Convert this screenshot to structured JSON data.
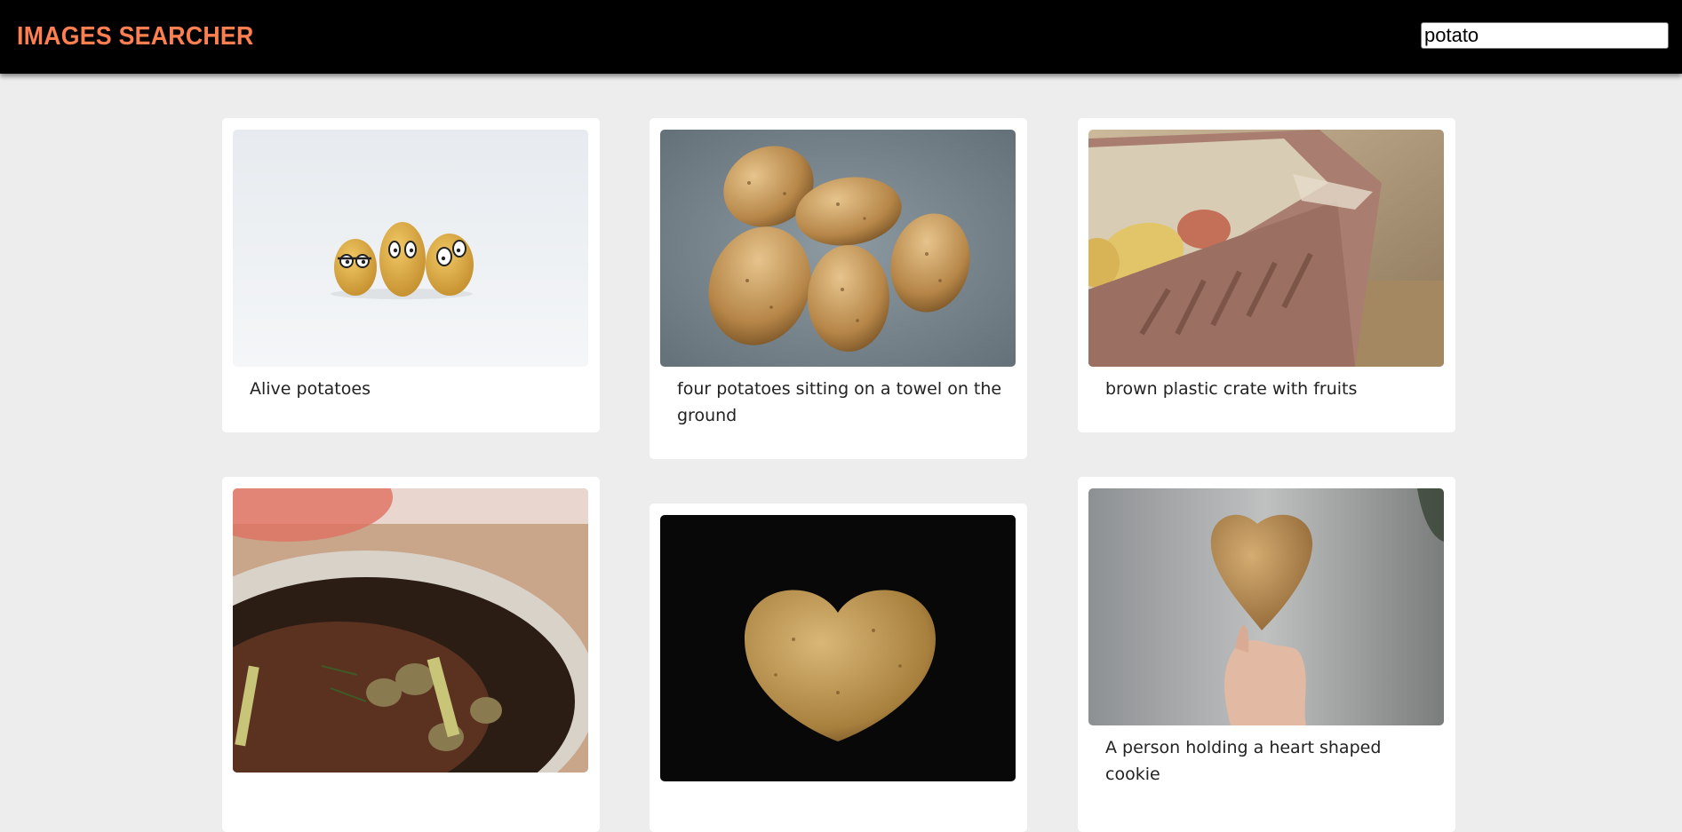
{
  "header": {
    "title": "IMAGES SEARCHER",
    "search_value": "potato"
  },
  "results": [
    {
      "caption": "Alive potatoes",
      "image": "alive-potatoes-image"
    },
    {
      "caption": "four potatoes sitting on a towel on the ground",
      "image": "potatoes-on-towel-image"
    },
    {
      "caption": "brown plastic crate with fruits",
      "image": "crate-with-fruits-image"
    },
    {
      "caption": "",
      "image": "roasted-potatoes-pot-image"
    },
    {
      "caption": "",
      "image": "heart-potato-dark-image"
    },
    {
      "caption": "A person holding a heart shaped cookie",
      "image": "hand-heart-potato-image"
    }
  ],
  "colors": {
    "accent": "#ff7f50",
    "header_bg": "#000000",
    "page_bg": "#ededed",
    "card_bg": "#ffffff"
  }
}
